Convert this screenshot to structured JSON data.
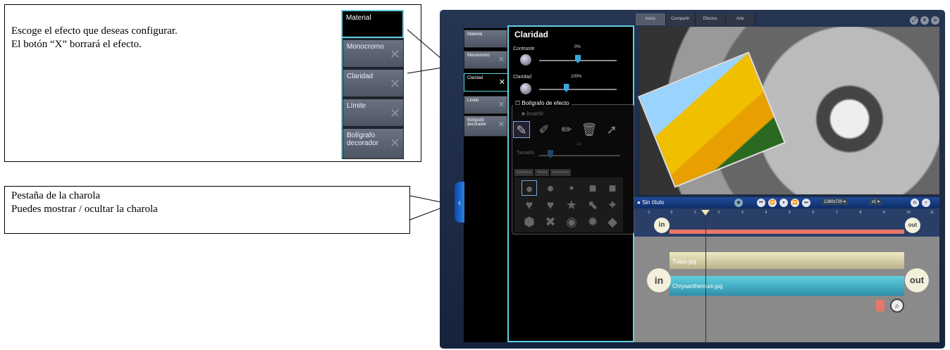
{
  "callouts": {
    "effects": {
      "line1": "Escoge el efecto que deseas configurar.",
      "line2": "El botón “X” borrará el efecto."
    },
    "tray": {
      "line1": "Pestaña de la charola",
      "line2": "Puedes mostrar / ocultar la charola"
    }
  },
  "zoom_tabs": [
    "Material",
    "Monocromo",
    "Claridad",
    "Límite",
    "Bolígrafo decorador"
  ],
  "app": {
    "menu": [
      "Inicio",
      "Compartir",
      "Efectos",
      "Arte"
    ],
    "window_icons": [
      "resize-icon",
      "close-icon",
      "menu-icon"
    ],
    "tray_tabs": [
      "Material",
      "Monocromo",
      "Claridad",
      "Límite",
      "Bolígrafo decorador"
    ],
    "active_tab": "Claridad",
    "panel": {
      "title": "Claridad",
      "contrast_label": "Contraste",
      "contrast_value": "0%",
      "contrast_level": 0.5,
      "clarity_label": "Claridad",
      "clarity_value": "100%",
      "clarity_level": 0.35,
      "pen_label": "Bolígrafo de efecto",
      "invert_label": "Invertir",
      "size_label": "Tamaño",
      "size_value": "1.0",
      "sub_tabs": [
        "Estampar",
        "Pincel",
        "Animación"
      ],
      "tool_icons": [
        "pen-icon",
        "brush-icon",
        "eraser-icon",
        "trash-icon",
        "pointer-icon"
      ]
    },
    "player": {
      "title": "Sin título",
      "resolution": "1280x720",
      "speed": "x1"
    },
    "ruler_ticks": [
      "-1",
      "0",
      "1",
      "2",
      "3",
      "4",
      "5",
      "6",
      "7",
      "8",
      "9",
      "10",
      "11"
    ],
    "timeline": {
      "in_label": "in",
      "out_label": "out",
      "clip1": "Tulips.jpg",
      "clip2": "Chrysanthemum.jpg"
    }
  }
}
